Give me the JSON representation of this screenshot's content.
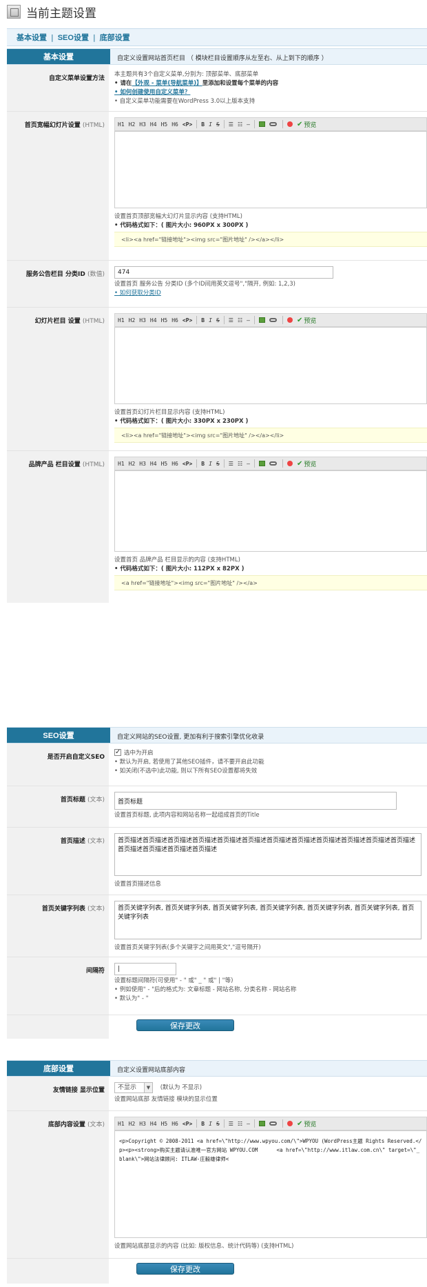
{
  "page": {
    "title": "当前主题设置"
  },
  "nav": {
    "tab1": "基本设置",
    "tab2": "SEO设置",
    "tab3": "底部设置",
    "sep": "|"
  },
  "basic": {
    "label": "基本设置",
    "desc": "自定义设置网站首页栏目 （ 模块栏目设置顺序从左至右、从上到下的顺序 ）",
    "menu": {
      "label": "自定义菜单设置方法",
      "note1": "本主题共有3个自定义菜单,分别为: 顶部菜单、底部菜单",
      "note2_pre": "• 请在",
      "note2_link": "【外观 - 菜单(导航菜单)】",
      "note2_post": "里添加和设置每个菜单的内容",
      "note3": "• 如何创建使用自定义菜单？",
      "note4": "• 自定义菜单功能需要在WordPress 3.0以上版本支持"
    },
    "banner": {
      "label": "首页宽幅幻灯片设置",
      "hint": "(HTML)",
      "note1": "设置首页顶部宽幅大幻灯片显示内容 (支持HTML)",
      "note2": "• 代码格式如下：( 图片大小: 960PX x 300PX )",
      "code": "<li><a href=\"链接地址\"><img src=\"图片地址\" /></a></li>"
    },
    "notice": {
      "label": "服务公告栏目 分类ID",
      "hint": "(数值)",
      "value": "474",
      "note1": "设置首页 服务公告 分类ID (多个ID间用英文逗号\",\"隔开, 例如: 1,2,3)",
      "note2": "• 如何获取分类ID"
    },
    "slide": {
      "label": "幻灯片栏目 设置",
      "hint": "(HTML)",
      "note1": "设置首页幻灯片栏目显示内容 (支持HTML)",
      "note2": "• 代码格式如下：( 图片大小: 330PX x 230PX )",
      "code": "<li><a href=\"链接地址\"><img src=\"图片地址\" /></a></li>"
    },
    "brand": {
      "label": "品牌产品 栏目设置",
      "hint": "(HTML)",
      "note1": "设置首页 品牌产品 栏目显示的内容 (支持HTML)",
      "note2": "• 代码格式如下：( 图片大小: 112PX x 82PX )",
      "code": "<a href=\"链接地址\"><img src=\"图片地址\" /></a>"
    }
  },
  "toolbar": {
    "h1": "H1",
    "h2": "H2",
    "h3": "H3",
    "h4": "H4",
    "h5": "H5",
    "h6": "H6",
    "p": "<P>",
    "b": "B",
    "i": "I",
    "s": "S",
    "ul": "☰",
    "ol": "☷",
    "hr": "—",
    "preview": "预览",
    "check": "✔"
  },
  "seo": {
    "label": "SEO设置",
    "desc": "自定义网站的SEO设置, 更加有利于搜索引擎优化收录",
    "enable": {
      "label": "是否开启自定义SEO",
      "checkbox_label": "选中为开启",
      "note1": "• 默认为开启, 若使用了其他SEO插件，请不要开启此功能",
      "note2": "• 如关闭(不选中)此功能, 则以下所有SEO设置都将失效"
    },
    "title": {
      "label": "首页标题",
      "hint": "(文本)",
      "value": "首页标题",
      "note": "设置首页标题, 此项内容和网站名称一起组成首页的Title"
    },
    "description": {
      "label": "首页描述",
      "hint": "(文本)",
      "value": "首页描述首页描述首页描述首页描述首页描述首页描述首页描述首页描述首页描述首页描述首页描述首页描述首页描述首页描述首页描述首页描述",
      "note": "设置首页描述信息"
    },
    "keywords": {
      "label": "首页关键字列表",
      "hint": "(文本)",
      "value": "首页关键字列表, 首页关键字列表, 首页关键字列表, 首页关键字列表, 首页关键字列表, 首页关键字列表, 首页关键字列表",
      "note": "设置首页关键字列表(多个关键字之间用英文\",\"逗号隔开)"
    },
    "separator": {
      "label": "间隔符",
      "value": "|",
      "note1": "设置标题间隔符(可使用\" - \" 或\" _ \" 或\" | \"等)",
      "note2": "• 例如使用\" - \"后的格式为: 文章标题 - 网站名称, 分类名称 - 网站名称",
      "note3": "• 默认为\" - \""
    },
    "save": "保存更改"
  },
  "footer": {
    "label": "底部设置",
    "desc": "自定义设置网站底部内容",
    "links": {
      "label": "友情链接 显示位置",
      "select": "不显示",
      "default": "(默认为 不显示)",
      "note": "设置网站底部 友情链接 模块的显示位置"
    },
    "content": {
      "label": "底部内容设置",
      "hint": "(文本)",
      "code": "<p>Copyright © 2008-2011 <a href=\\\"http://www.wpyou.com/\\\">WPYOU (WordPress主题 Rights Reserved.</p><p><strong>购买主题请认准唯一官方网站 WPYOU.COM      <a href=\\\"http://www.itlaw.com.cn\\\" target=\\\"_blank\\\">网站法律顾问: ITLAW-庄毅雄律师<",
      "note": "设置网站底部显示的内容 (比如: 版权信息、统计代码等) (支持HTML)"
    },
    "save": "保存更改"
  }
}
